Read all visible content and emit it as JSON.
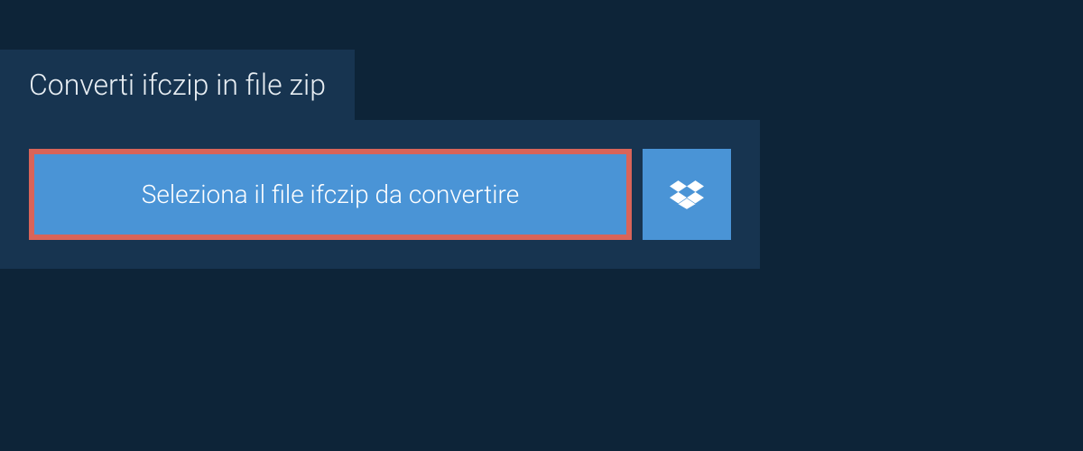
{
  "tab": {
    "title": "Converti ifczip in file zip"
  },
  "buttons": {
    "select_file_label": "Seleziona il file ifczip da convertire"
  },
  "colors": {
    "background": "#0d2438",
    "panel": "#173450",
    "button": "#4a94d6",
    "highlight_border": "#d96459"
  }
}
